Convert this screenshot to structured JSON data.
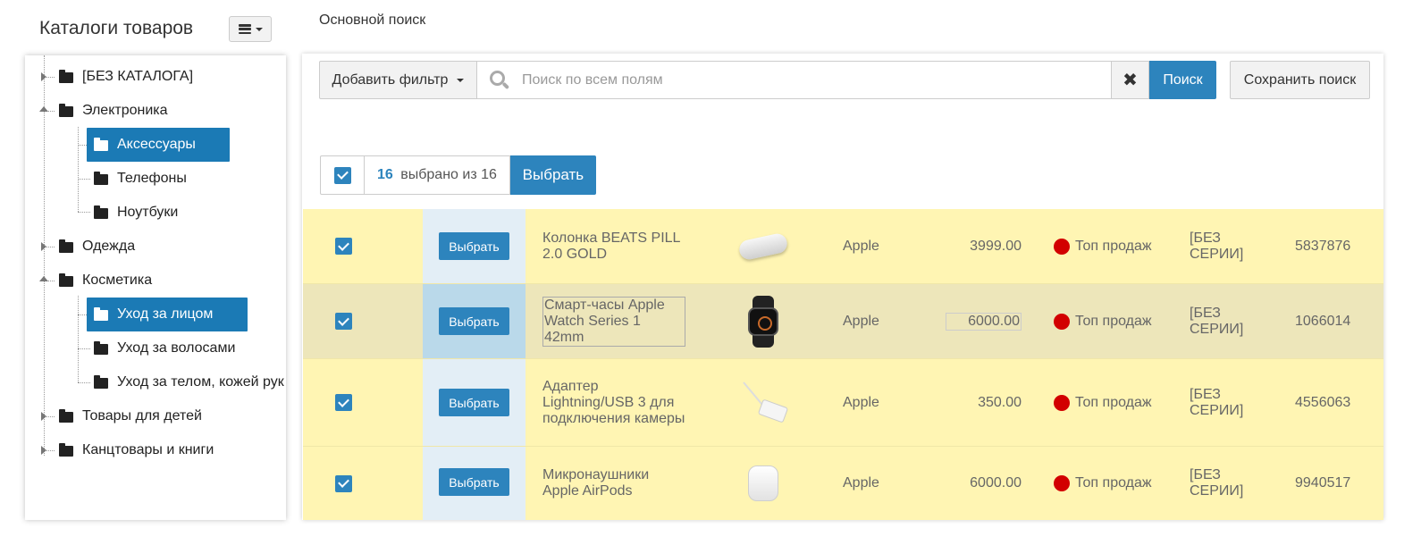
{
  "sidebar": {
    "title": "Каталоги товаров",
    "items": [
      {
        "label": "[БЕЗ КАТАЛОГА]"
      },
      {
        "label": "Электроника"
      },
      {
        "label": "Аксессуары"
      },
      {
        "label": "Телефоны"
      },
      {
        "label": "Ноутбуки"
      },
      {
        "label": "Одежда"
      },
      {
        "label": "Косметика"
      },
      {
        "label": "Уход за лицом"
      },
      {
        "label": "Уход за волосами"
      },
      {
        "label": "Уход за телом, кожей рук"
      },
      {
        "label": "Товары для детей"
      },
      {
        "label": "Канцтовары и книги"
      }
    ]
  },
  "main": {
    "title": "Основной поиск",
    "filter_label": "Добавить фильтр",
    "search": {
      "placeholder": "Поиск по всем полям",
      "value": ""
    },
    "clear_label": "✖",
    "search_button": "Поиск",
    "save_button": "Сохранить поиск"
  },
  "selection": {
    "count": "16",
    "of_text": " выбрано из 16",
    "select_button": "Выбрать"
  },
  "rows": [
    {
      "button": "Выбрать",
      "name": "Колонка BEATS PILL 2.0 GOLD",
      "brand": "Apple",
      "price": "3999.00",
      "status": "Топ продаж",
      "series": "[БЕЗ СЕРИИ]",
      "code": "5837876"
    },
    {
      "button": "Выбрать",
      "name": "Смарт-часы Apple Watch Series 1 42mm",
      "brand": "Apple",
      "price": "6000.00",
      "status": "Топ продаж",
      "series": "[БЕЗ СЕРИИ]",
      "code": "1066014"
    },
    {
      "button": "Выбрать",
      "name": "Адаптер Lightning/USB 3 для подключения камеры",
      "brand": "Apple",
      "price": "350.00",
      "status": "Топ продаж",
      "series": "[БЕЗ СЕРИИ]",
      "code": "4556063"
    },
    {
      "button": "Выбрать",
      "name": "Микронаушники Apple AirPods",
      "brand": "Apple",
      "price": "6000.00",
      "status": "Топ продаж",
      "series": "[БЕЗ СЕРИИ]",
      "code": "9940517"
    }
  ],
  "colors": {
    "accent": "#2d84bd",
    "tree_selected": "#1b7ab5",
    "row_bg": "#fff5b3",
    "status_dot": "#d20000"
  }
}
